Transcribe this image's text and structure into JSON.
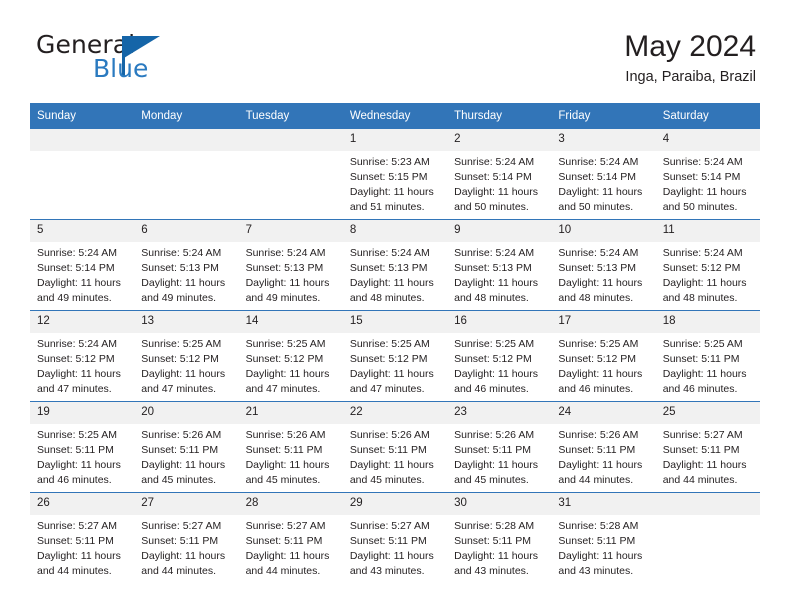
{
  "brand": {
    "name_part1": "General",
    "name_part2": "Blue",
    "flag_color": "#1565a8",
    "blue_text_color": "#2a7ac0"
  },
  "header": {
    "title": "May 2024",
    "subtitle": "Inga, Paraiba, Brazil"
  },
  "theme": {
    "header_band": "#3275b8",
    "daynum_band": "#f1f1f1",
    "text": "#231f20"
  },
  "weekday_headers": [
    "Sunday",
    "Monday",
    "Tuesday",
    "Wednesday",
    "Thursday",
    "Friday",
    "Saturday"
  ],
  "weeks": [
    [
      {
        "day": "",
        "sunrise": "",
        "sunset": "",
        "daylight_line1": "",
        "daylight_line2": ""
      },
      {
        "day": "",
        "sunrise": "",
        "sunset": "",
        "daylight_line1": "",
        "daylight_line2": ""
      },
      {
        "day": "",
        "sunrise": "",
        "sunset": "",
        "daylight_line1": "",
        "daylight_line2": ""
      },
      {
        "day": "1",
        "sunrise": "Sunrise: 5:23 AM",
        "sunset": "Sunset: 5:15 PM",
        "daylight_line1": "Daylight: 11 hours",
        "daylight_line2": "and 51 minutes."
      },
      {
        "day": "2",
        "sunrise": "Sunrise: 5:24 AM",
        "sunset": "Sunset: 5:14 PM",
        "daylight_line1": "Daylight: 11 hours",
        "daylight_line2": "and 50 minutes."
      },
      {
        "day": "3",
        "sunrise": "Sunrise: 5:24 AM",
        "sunset": "Sunset: 5:14 PM",
        "daylight_line1": "Daylight: 11 hours",
        "daylight_line2": "and 50 minutes."
      },
      {
        "day": "4",
        "sunrise": "Sunrise: 5:24 AM",
        "sunset": "Sunset: 5:14 PM",
        "daylight_line1": "Daylight: 11 hours",
        "daylight_line2": "and 50 minutes."
      }
    ],
    [
      {
        "day": "5",
        "sunrise": "Sunrise: 5:24 AM",
        "sunset": "Sunset: 5:14 PM",
        "daylight_line1": "Daylight: 11 hours",
        "daylight_line2": "and 49 minutes."
      },
      {
        "day": "6",
        "sunrise": "Sunrise: 5:24 AM",
        "sunset": "Sunset: 5:13 PM",
        "daylight_line1": "Daylight: 11 hours",
        "daylight_line2": "and 49 minutes."
      },
      {
        "day": "7",
        "sunrise": "Sunrise: 5:24 AM",
        "sunset": "Sunset: 5:13 PM",
        "daylight_line1": "Daylight: 11 hours",
        "daylight_line2": "and 49 minutes."
      },
      {
        "day": "8",
        "sunrise": "Sunrise: 5:24 AM",
        "sunset": "Sunset: 5:13 PM",
        "daylight_line1": "Daylight: 11 hours",
        "daylight_line2": "and 48 minutes."
      },
      {
        "day": "9",
        "sunrise": "Sunrise: 5:24 AM",
        "sunset": "Sunset: 5:13 PM",
        "daylight_line1": "Daylight: 11 hours",
        "daylight_line2": "and 48 minutes."
      },
      {
        "day": "10",
        "sunrise": "Sunrise: 5:24 AM",
        "sunset": "Sunset: 5:13 PM",
        "daylight_line1": "Daylight: 11 hours",
        "daylight_line2": "and 48 minutes."
      },
      {
        "day": "11",
        "sunrise": "Sunrise: 5:24 AM",
        "sunset": "Sunset: 5:12 PM",
        "daylight_line1": "Daylight: 11 hours",
        "daylight_line2": "and 48 minutes."
      }
    ],
    [
      {
        "day": "12",
        "sunrise": "Sunrise: 5:24 AM",
        "sunset": "Sunset: 5:12 PM",
        "daylight_line1": "Daylight: 11 hours",
        "daylight_line2": "and 47 minutes."
      },
      {
        "day": "13",
        "sunrise": "Sunrise: 5:25 AM",
        "sunset": "Sunset: 5:12 PM",
        "daylight_line1": "Daylight: 11 hours",
        "daylight_line2": "and 47 minutes."
      },
      {
        "day": "14",
        "sunrise": "Sunrise: 5:25 AM",
        "sunset": "Sunset: 5:12 PM",
        "daylight_line1": "Daylight: 11 hours",
        "daylight_line2": "and 47 minutes."
      },
      {
        "day": "15",
        "sunrise": "Sunrise: 5:25 AM",
        "sunset": "Sunset: 5:12 PM",
        "daylight_line1": "Daylight: 11 hours",
        "daylight_line2": "and 47 minutes."
      },
      {
        "day": "16",
        "sunrise": "Sunrise: 5:25 AM",
        "sunset": "Sunset: 5:12 PM",
        "daylight_line1": "Daylight: 11 hours",
        "daylight_line2": "and 46 minutes."
      },
      {
        "day": "17",
        "sunrise": "Sunrise: 5:25 AM",
        "sunset": "Sunset: 5:12 PM",
        "daylight_line1": "Daylight: 11 hours",
        "daylight_line2": "and 46 minutes."
      },
      {
        "day": "18",
        "sunrise": "Sunrise: 5:25 AM",
        "sunset": "Sunset: 5:11 PM",
        "daylight_line1": "Daylight: 11 hours",
        "daylight_line2": "and 46 minutes."
      }
    ],
    [
      {
        "day": "19",
        "sunrise": "Sunrise: 5:25 AM",
        "sunset": "Sunset: 5:11 PM",
        "daylight_line1": "Daylight: 11 hours",
        "daylight_line2": "and 46 minutes."
      },
      {
        "day": "20",
        "sunrise": "Sunrise: 5:26 AM",
        "sunset": "Sunset: 5:11 PM",
        "daylight_line1": "Daylight: 11 hours",
        "daylight_line2": "and 45 minutes."
      },
      {
        "day": "21",
        "sunrise": "Sunrise: 5:26 AM",
        "sunset": "Sunset: 5:11 PM",
        "daylight_line1": "Daylight: 11 hours",
        "daylight_line2": "and 45 minutes."
      },
      {
        "day": "22",
        "sunrise": "Sunrise: 5:26 AM",
        "sunset": "Sunset: 5:11 PM",
        "daylight_line1": "Daylight: 11 hours",
        "daylight_line2": "and 45 minutes."
      },
      {
        "day": "23",
        "sunrise": "Sunrise: 5:26 AM",
        "sunset": "Sunset: 5:11 PM",
        "daylight_line1": "Daylight: 11 hours",
        "daylight_line2": "and 45 minutes."
      },
      {
        "day": "24",
        "sunrise": "Sunrise: 5:26 AM",
        "sunset": "Sunset: 5:11 PM",
        "daylight_line1": "Daylight: 11 hours",
        "daylight_line2": "and 44 minutes."
      },
      {
        "day": "25",
        "sunrise": "Sunrise: 5:27 AM",
        "sunset": "Sunset: 5:11 PM",
        "daylight_line1": "Daylight: 11 hours",
        "daylight_line2": "and 44 minutes."
      }
    ],
    [
      {
        "day": "26",
        "sunrise": "Sunrise: 5:27 AM",
        "sunset": "Sunset: 5:11 PM",
        "daylight_line1": "Daylight: 11 hours",
        "daylight_line2": "and 44 minutes."
      },
      {
        "day": "27",
        "sunrise": "Sunrise: 5:27 AM",
        "sunset": "Sunset: 5:11 PM",
        "daylight_line1": "Daylight: 11 hours",
        "daylight_line2": "and 44 minutes."
      },
      {
        "day": "28",
        "sunrise": "Sunrise: 5:27 AM",
        "sunset": "Sunset: 5:11 PM",
        "daylight_line1": "Daylight: 11 hours",
        "daylight_line2": "and 44 minutes."
      },
      {
        "day": "29",
        "sunrise": "Sunrise: 5:27 AM",
        "sunset": "Sunset: 5:11 PM",
        "daylight_line1": "Daylight: 11 hours",
        "daylight_line2": "and 43 minutes."
      },
      {
        "day": "30",
        "sunrise": "Sunrise: 5:28 AM",
        "sunset": "Sunset: 5:11 PM",
        "daylight_line1": "Daylight: 11 hours",
        "daylight_line2": "and 43 minutes."
      },
      {
        "day": "31",
        "sunrise": "Sunrise: 5:28 AM",
        "sunset": "Sunset: 5:11 PM",
        "daylight_line1": "Daylight: 11 hours",
        "daylight_line2": "and 43 minutes."
      },
      {
        "day": "",
        "sunrise": "",
        "sunset": "",
        "daylight_line1": "",
        "daylight_line2": ""
      }
    ]
  ]
}
